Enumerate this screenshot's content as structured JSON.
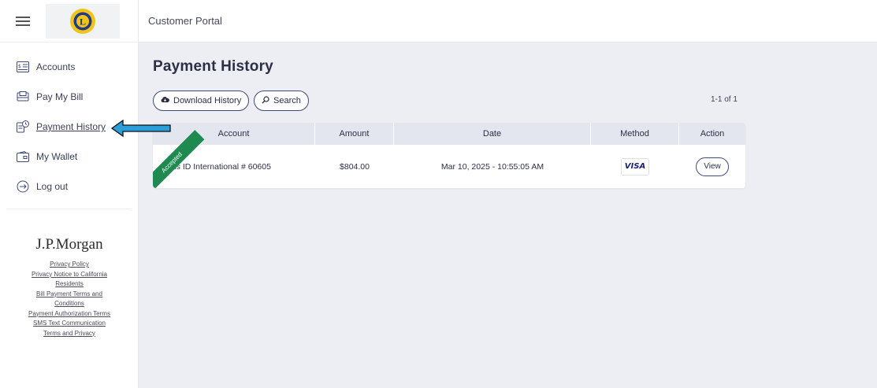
{
  "app": {
    "portal_title": "Customer Portal"
  },
  "sidebar": {
    "items": [
      {
        "label": "Accounts",
        "icon": "accounts-icon"
      },
      {
        "label": "Pay My Bill",
        "icon": "pay-bill-icon"
      },
      {
        "label": "Payment History",
        "icon": "payment-history-icon",
        "active": true
      },
      {
        "label": "My Wallet",
        "icon": "wallet-icon"
      },
      {
        "label": "Log out",
        "icon": "logout-icon"
      }
    ]
  },
  "footer": {
    "brand": "J.P.Morgan",
    "links": [
      "Privacy Policy",
      "Privacy Notice to California",
      "Residents",
      "Bill Payment Terms and",
      "Conditions",
      "Payment Authorization Terms",
      "SMS Text Communication",
      "Terms and Privacy"
    ]
  },
  "main": {
    "title": "Payment History",
    "download_label": "Download History",
    "search_label": "Search",
    "pager": "1-1 of 1",
    "columns": [
      "Account",
      "Amount",
      "Date",
      "Method",
      "Action"
    ],
    "rows": [
      {
        "status": "Accepted",
        "account": "ons ID International # 60605",
        "amount": "$804.00",
        "date": "Mar 10, 2025 - 10:55:05 AM",
        "method": "VISA",
        "action": "View"
      }
    ]
  },
  "colors": {
    "accent": "#3e4a7a",
    "accepted_ribbon": "#1e8a50",
    "annotation_arrow": "#2a9fd8"
  }
}
